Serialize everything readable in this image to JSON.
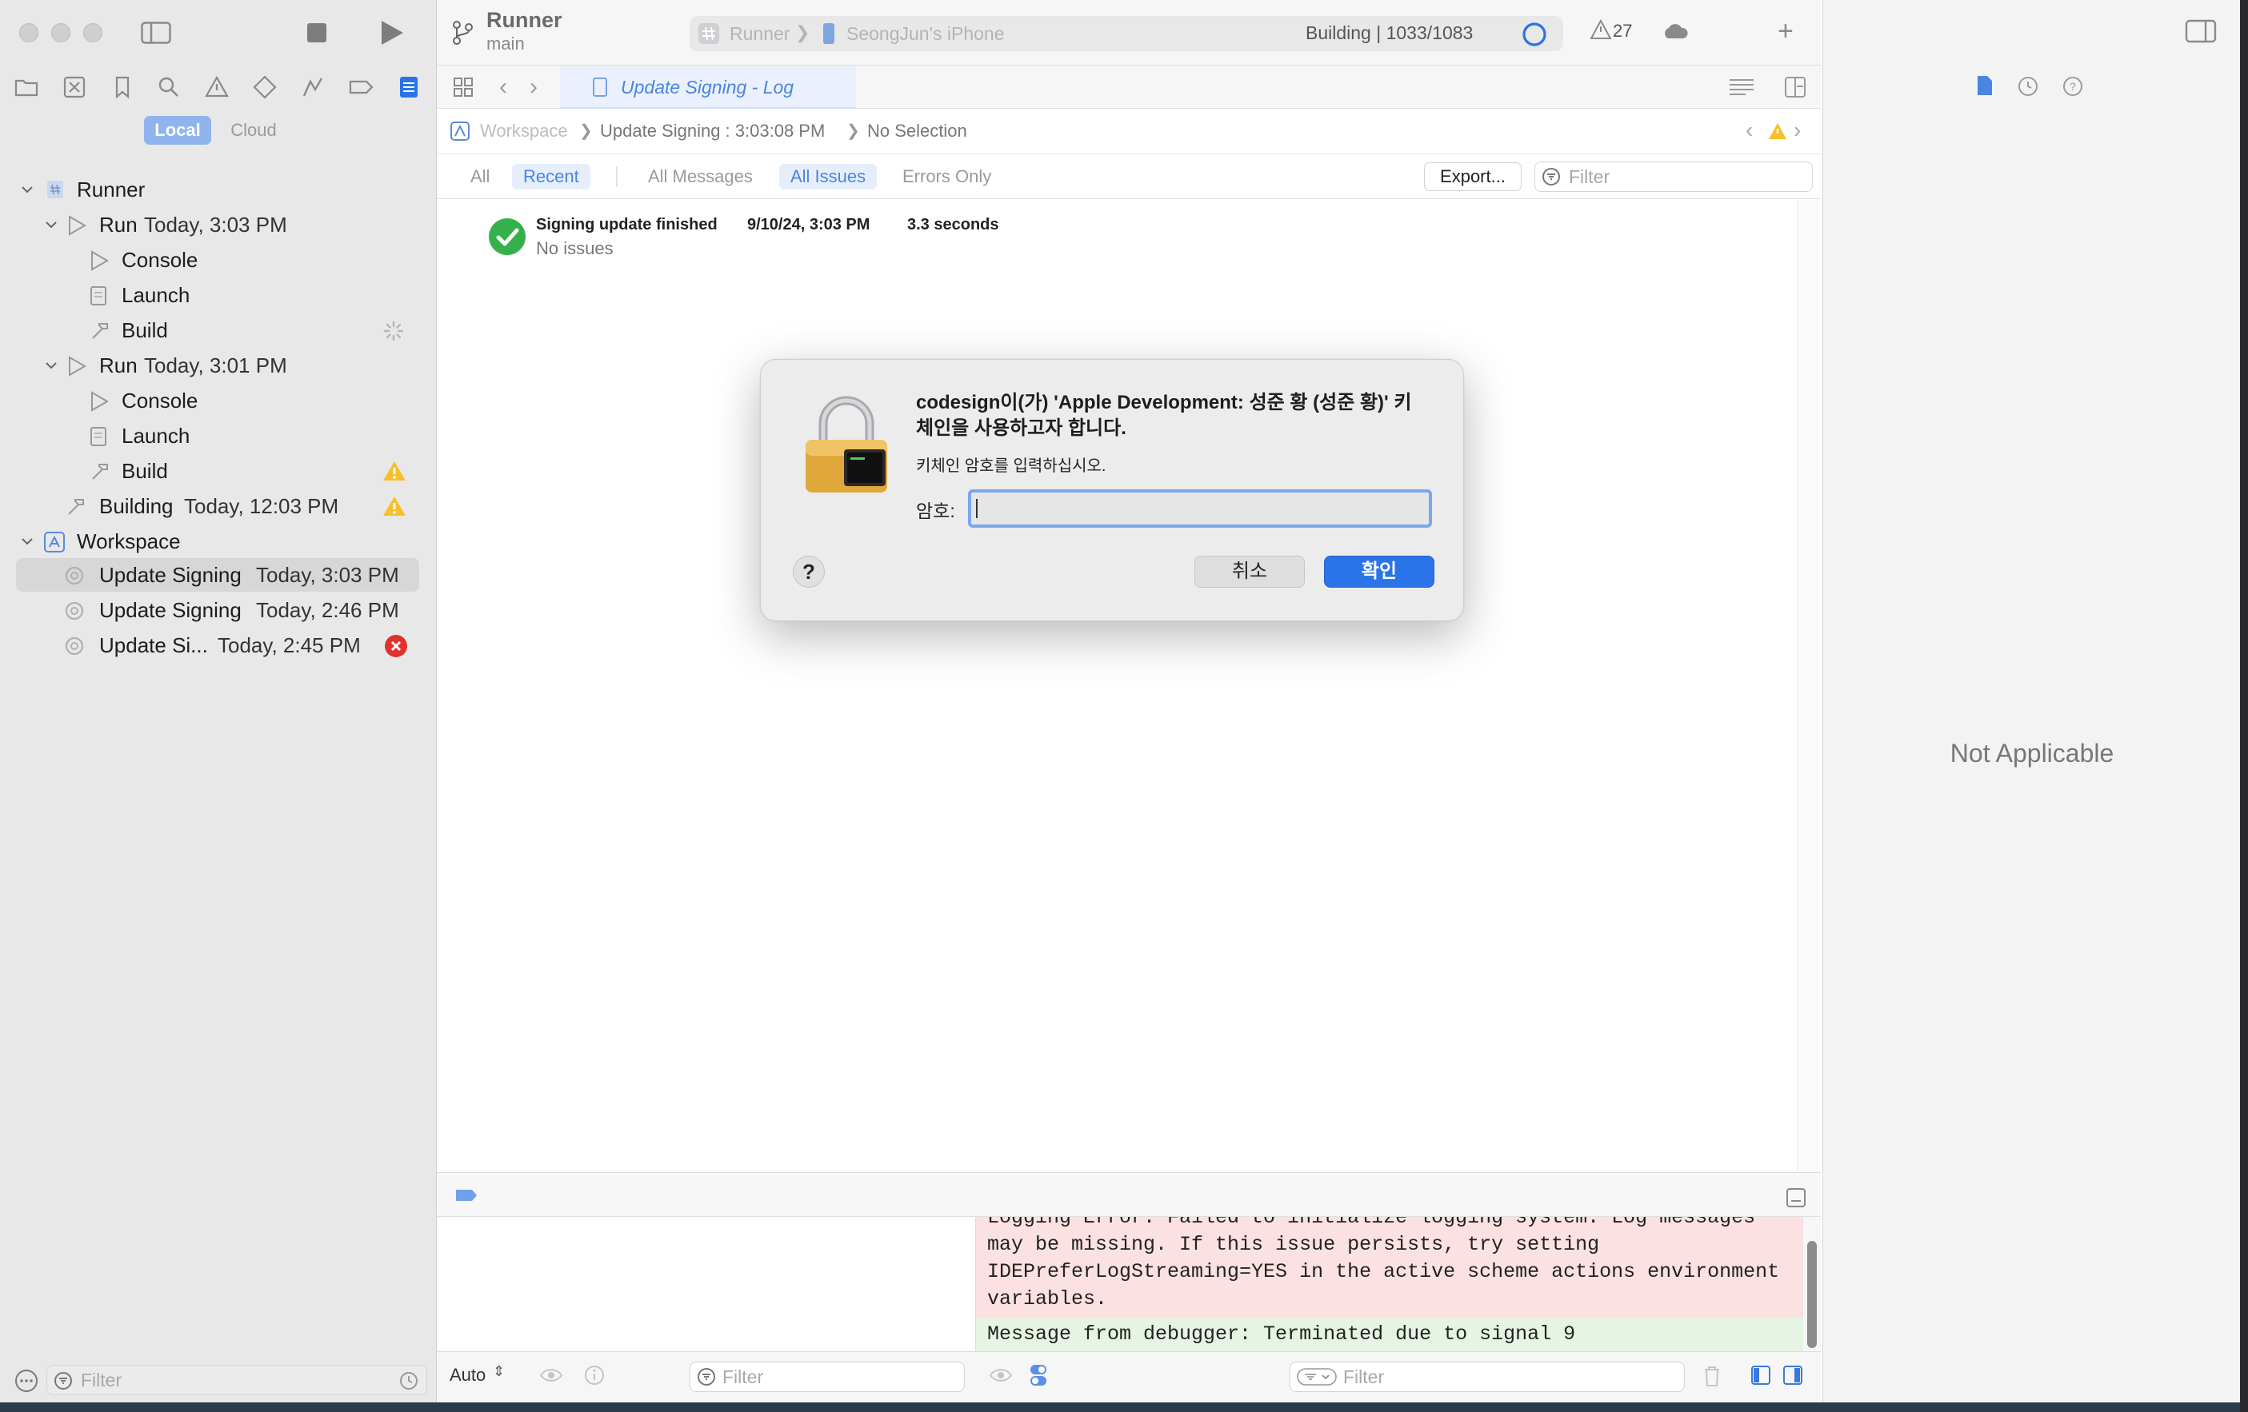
{
  "colors": {
    "accent": "#2a73e8",
    "warning": "#f5c02c",
    "error": "#e0322f",
    "success": "#35b04a",
    "console_error_bg": "#fbe1e1",
    "console_ok_bg": "#e6f4e3"
  },
  "toolbar": {
    "project": "Runner",
    "branch": "main",
    "scheme": "Runner",
    "device": "SeongJun's iPhone",
    "status": "Building | 1033/1083",
    "warning_count": "27"
  },
  "sidebar": {
    "scope_local": "Local",
    "scope_cloud": "Cloud",
    "tree": [
      {
        "kind": "project",
        "label": "Runner",
        "time": ""
      },
      {
        "kind": "run",
        "label": "Run",
        "time": "Today, 3:03 PM"
      },
      {
        "kind": "step",
        "label": "Console",
        "time": ""
      },
      {
        "kind": "step",
        "label": "Launch",
        "time": ""
      },
      {
        "kind": "step",
        "label": "Build",
        "time": ""
      },
      {
        "kind": "run",
        "label": "Run",
        "time": "Today, 3:01 PM"
      },
      {
        "kind": "step",
        "label": "Console",
        "time": ""
      },
      {
        "kind": "step",
        "label": "Launch",
        "time": ""
      },
      {
        "kind": "step",
        "label": "Build",
        "time": ""
      },
      {
        "kind": "build",
        "label": "Building",
        "time": "Today, 12:03 PM"
      },
      {
        "kind": "workspace",
        "label": "Workspace",
        "time": ""
      },
      {
        "kind": "sign",
        "label": "Update Signing",
        "time": "Today, 3:03 PM"
      },
      {
        "kind": "sign",
        "label": "Update Signing",
        "time": "Today, 2:46 PM"
      },
      {
        "kind": "sign",
        "label": "Update Si...",
        "time": "Today, 2:45 PM"
      }
    ],
    "filter_placeholder": "Filter"
  },
  "editor": {
    "tab_title": "Update Signing - Log",
    "jump": {
      "root": "Workspace",
      "item": "Update Signing : 3:03:08 PM",
      "selection": "No Selection"
    },
    "filters": {
      "all": "All",
      "recent": "Recent",
      "all_messages": "All Messages",
      "all_issues": "All Issues",
      "errors_only": "Errors Only"
    },
    "export_label": "Export...",
    "filter_placeholder": "Filter",
    "log": {
      "title": "Signing update finished",
      "date": "9/10/24, 3:03 PM",
      "duration": "3.3 seconds",
      "status": "No issues"
    }
  },
  "dialog": {
    "title": "codesign이(가) 'Apple Development: 성준 황 (성준 황)' 키체인을 사용하고자 합니다.",
    "message": "키체인 암호를 입력하십시오.",
    "password_label": "암호:",
    "help": "?",
    "cancel_label": "취소",
    "ok_label": "확인"
  },
  "debug": {
    "auto_label": "Auto",
    "filter_placeholder": "Filter",
    "console_lines": [
      "Logging Error: Failed to initialize logging system. Log messages",
      "may be missing. If this issue persists, try setting",
      "IDEPreferLogStreaming=YES in the active scheme actions environment",
      "variables."
    ],
    "console_last": "Message from debugger: Terminated due to signal 9"
  },
  "inspector": {
    "empty_label": "Not Applicable"
  }
}
